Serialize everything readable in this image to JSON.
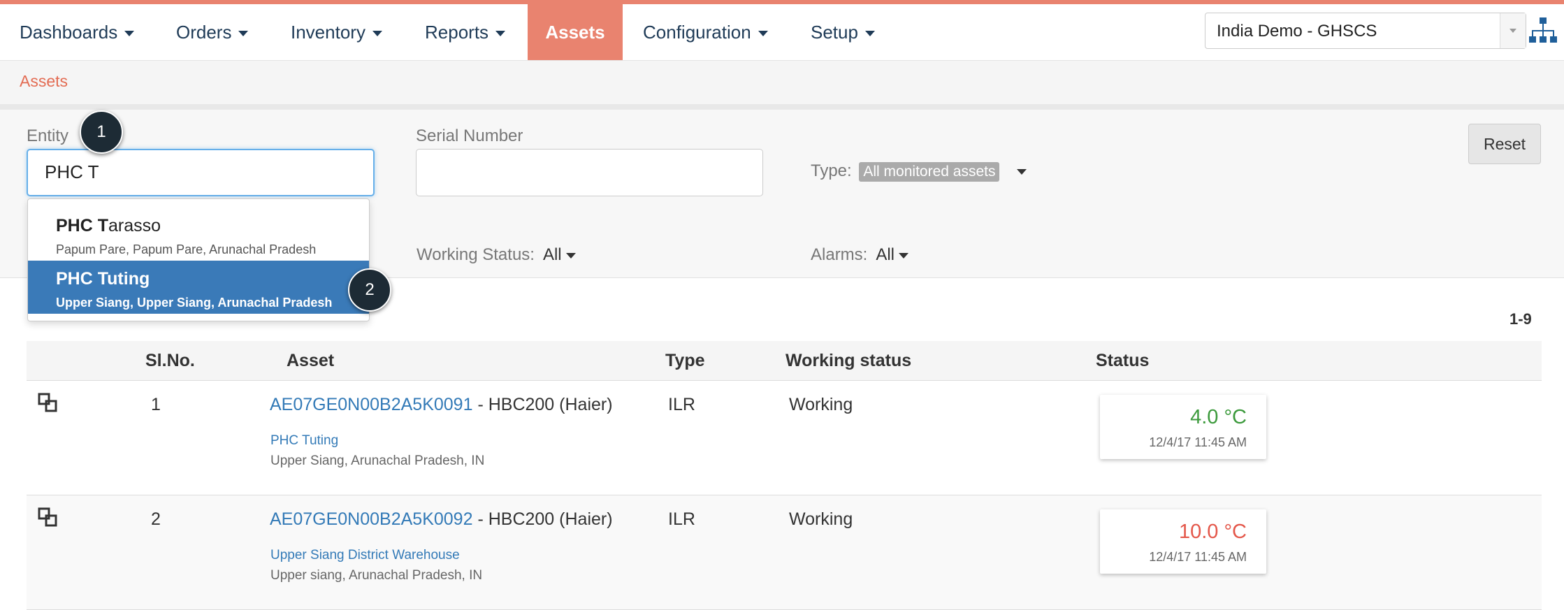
{
  "nav": {
    "items": [
      {
        "label": "Dashboards",
        "dropdown": true
      },
      {
        "label": "Orders",
        "dropdown": true
      },
      {
        "label": "Inventory",
        "dropdown": true
      },
      {
        "label": "Reports",
        "dropdown": true
      },
      {
        "label": "Assets",
        "dropdown": false,
        "active": true
      },
      {
        "label": "Configuration",
        "dropdown": true
      },
      {
        "label": "Setup",
        "dropdown": true
      }
    ],
    "domain_select": "India Demo - GHSCS",
    "hierarchy_icon": "org-chart-icon"
  },
  "breadcrumb": "Assets",
  "filters": {
    "entity_label": "Entity",
    "entity_value": "PHC T",
    "serial_label": "Serial Number",
    "serial_value": "",
    "type_label": "Type:",
    "type_value": "All monitored assets",
    "working_status_label": "Working Status:",
    "working_status_value": "All",
    "alarms_label": "Alarms:",
    "alarms_value": "All",
    "reset_label": "Reset"
  },
  "entity_suggestions": [
    {
      "bold": "PHC T",
      "rest": "arasso",
      "location": "Papum Pare, Papum Pare, Arunachal Pradesh",
      "selected": false
    },
    {
      "bold": "PHC T",
      "rest": "uting",
      "location": "Upper Siang, Upper Siang, Arunachal Pradesh",
      "selected": true
    }
  ],
  "markers": [
    "1",
    "2"
  ],
  "table": {
    "range": "1-9",
    "headers": [
      "Sl.No.",
      "Asset",
      "Type",
      "Working status",
      "Status"
    ],
    "rows": [
      {
        "sl": "1",
        "asset_id": "AE07GE0N00B2A5K0091",
        "asset_model": " - HBC200 (Haier)",
        "entity": "PHC Tuting",
        "location": "Upper Siang, Arunachal Pradesh, IN",
        "type": "ILR",
        "working": "Working",
        "temp": "4.0 °C",
        "temp_color": "#3c9a3c",
        "time": "12/4/17 11:45 AM"
      },
      {
        "sl": "2",
        "asset_id": "AE07GE0N00B2A5K0092",
        "asset_model": " - HBC200 (Haier)",
        "entity": "Upper Siang District Warehouse",
        "location": "Upper siang, Arunachal Pradesh, IN",
        "type": "ILR",
        "working": "Working",
        "temp": "10.0 °C",
        "temp_color": "#e4574a",
        "time": "12/4/17 11:45 AM"
      }
    ]
  }
}
